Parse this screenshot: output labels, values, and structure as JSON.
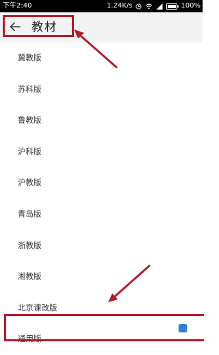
{
  "status_bar": {
    "time": "下午2:40",
    "speed": "1.24K/s",
    "battery": "100%",
    "battery_level": 1.0
  },
  "header": {
    "title": "教材",
    "back_icon": "arrow-left-icon"
  },
  "textbooks": [
    {
      "label": "冀教版"
    },
    {
      "label": "苏科版"
    },
    {
      "label": "鲁教版"
    },
    {
      "label": "沪科版"
    },
    {
      "label": "沪教版"
    },
    {
      "label": "青岛版"
    },
    {
      "label": "浙教版"
    },
    {
      "label": "湘教版"
    },
    {
      "label": "北京课改版"
    },
    {
      "label": "通用版"
    }
  ],
  "annotation": {
    "color": "#b31c2c"
  }
}
